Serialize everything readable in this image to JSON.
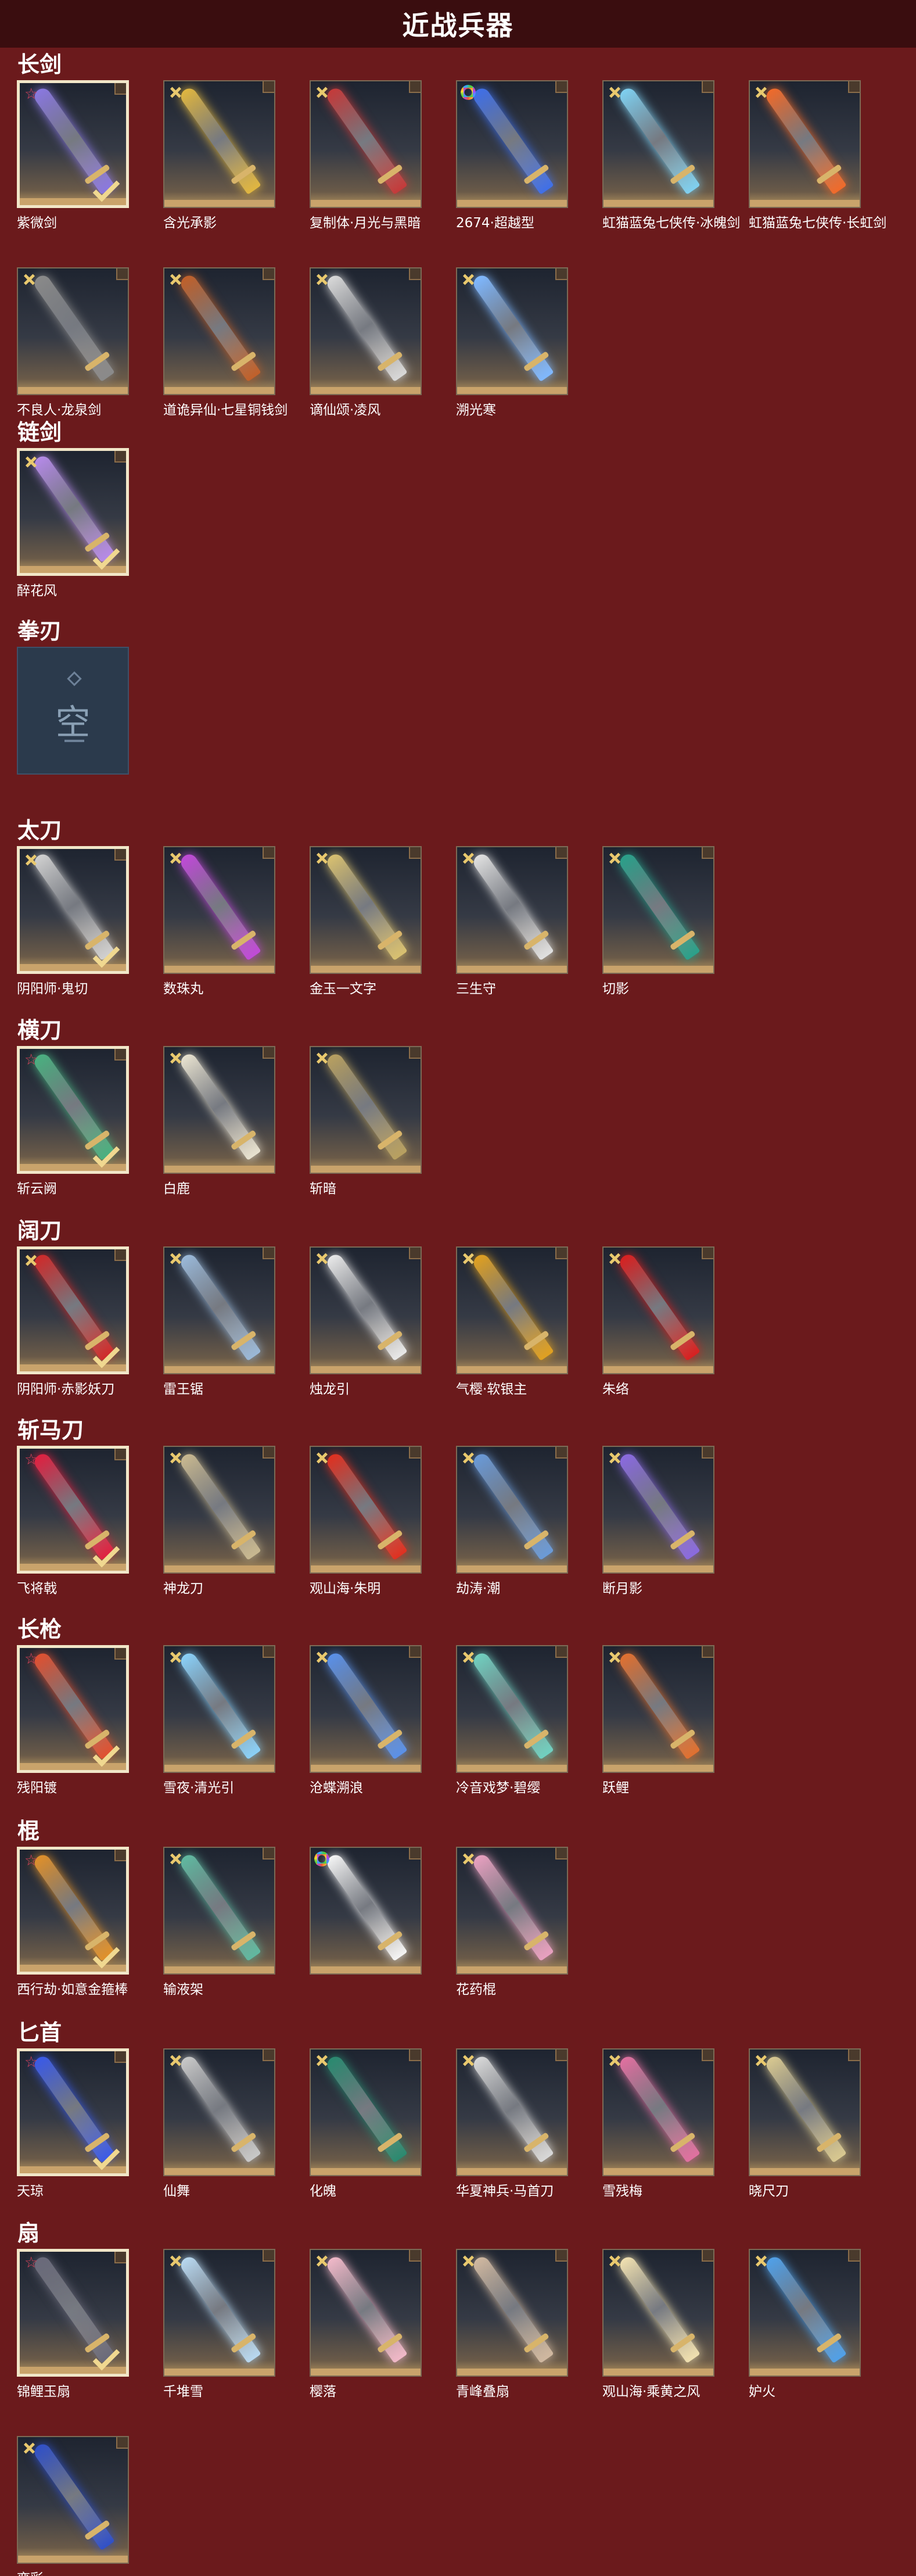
{
  "header": {
    "title": "近战兵器"
  },
  "sections": [
    {
      "name": "长剑",
      "items": [
        {
          "label": "紫微剑",
          "badge": "red",
          "selected": true,
          "color": "#8a78e0"
        },
        {
          "label": "含光承影",
          "badge": "gold",
          "selected": false,
          "color": "#e0b640"
        },
        {
          "label": "复制体·月光与黑暗",
          "badge": "gold",
          "selected": false,
          "color": "#c43a3a"
        },
        {
          "label": "2674·超越型",
          "badge": "rainbow",
          "selected": false,
          "color": "#3f6fe8"
        },
        {
          "label": "虹猫蓝兔七侠传·冰魄剑",
          "badge": "gold",
          "selected": false,
          "color": "#7fd0f0"
        },
        {
          "label": "虹猫蓝兔七侠传·长虹剑",
          "badge": "gold",
          "selected": false,
          "color": "#f06a2a"
        },
        {
          "label": "不良人·龙泉剑",
          "badge": "gold",
          "selected": false,
          "color": "#8a8a8a"
        },
        {
          "label": "道诡异仙·七星铜钱剑",
          "badge": "gold",
          "selected": false,
          "color": "#c0602a"
        },
        {
          "label": "谪仙颂·凌风",
          "badge": "gold",
          "selected": false,
          "color": "#d8d8d8"
        },
        {
          "label": "溯光寒",
          "badge": "gold",
          "selected": false,
          "color": "#7fb8ff"
        }
      ]
    },
    {
      "name": "链剑",
      "items": [
        {
          "label": "醉花风",
          "badge": "gold",
          "selected": true,
          "color": "#b58ae8"
        }
      ]
    },
    {
      "name": "拳刃",
      "items": [
        {
          "label": "",
          "badge": "none",
          "selected": false,
          "empty": true,
          "empty_glyph": "空",
          "color": "#2b3a4c"
        }
      ]
    },
    {
      "name": "太刀",
      "items": [
        {
          "label": "阴阳师·鬼切",
          "badge": "gold",
          "selected": true,
          "color": "#d0d0d0"
        },
        {
          "label": "数珠丸",
          "badge": "gold",
          "selected": false,
          "color": "#c04ad8"
        },
        {
          "label": "金玉一文字",
          "badge": "gold",
          "selected": false,
          "color": "#d8c070"
        },
        {
          "label": "三生守",
          "badge": "gold",
          "selected": false,
          "color": "#e0e0e0"
        },
        {
          "label": "切影",
          "badge": "gold",
          "selected": false,
          "color": "#2aa08a"
        }
      ]
    },
    {
      "name": "横刀",
      "items": [
        {
          "label": "斩云阙",
          "badge": "red",
          "selected": true,
          "color": "#4ab080"
        },
        {
          "label": "白鹿",
          "badge": "gold",
          "selected": false,
          "color": "#e8e2d0"
        },
        {
          "label": "斩暗",
          "badge": "gold",
          "selected": false,
          "color": "#b8a060"
        }
      ]
    },
    {
      "name": "阔刀",
      "items": [
        {
          "label": "阴阳师·赤影妖刀",
          "badge": "gold",
          "selected": true,
          "color": "#d02a2a"
        },
        {
          "label": "雷王锯",
          "badge": "gold",
          "selected": false,
          "color": "#9ab8d8"
        },
        {
          "label": "烛龙引",
          "badge": "gold",
          "selected": false,
          "color": "#e8e8e8"
        },
        {
          "label": "气樱·软银主",
          "badge": "gold",
          "selected": false,
          "color": "#e0a020"
        },
        {
          "label": "朱络",
          "badge": "gold",
          "selected": false,
          "color": "#d82020"
        }
      ]
    },
    {
      "name": "斩马刀",
      "items": [
        {
          "label": "飞将戟",
          "badge": "red",
          "selected": true,
          "color": "#e02040"
        },
        {
          "label": "神龙刀",
          "badge": "gold",
          "selected": false,
          "color": "#c8b890"
        },
        {
          "label": "观山海·朱明",
          "badge": "gold",
          "selected": false,
          "color": "#e03020"
        },
        {
          "label": "劫涛·潮",
          "badge": "gold",
          "selected": false,
          "color": "#6a9ad8"
        },
        {
          "label": "断月影",
          "badge": "gold",
          "selected": false,
          "color": "#8a6ae0"
        }
      ]
    },
    {
      "name": "长枪",
      "items": [
        {
          "label": "残阳镀",
          "badge": "red",
          "selected": true,
          "color": "#e05030"
        },
        {
          "label": "雪夜·清光引",
          "badge": "gold",
          "selected": false,
          "color": "#8ad0f8"
        },
        {
          "label": "沧蝶溯浪",
          "badge": "gold",
          "selected": false,
          "color": "#5a90e8"
        },
        {
          "label": "冷音戏梦·碧缨",
          "badge": "gold",
          "selected": false,
          "color": "#70d0c0"
        },
        {
          "label": "跃鲤",
          "badge": "gold",
          "selected": false,
          "color": "#e07030"
        }
      ]
    },
    {
      "name": "棍",
      "items": [
        {
          "label": "西行劫·如意金箍棒",
          "badge": "red",
          "selected": true,
          "color": "#e0902a"
        },
        {
          "label": "输液架",
          "badge": "gold",
          "selected": false,
          "color": "#60b8a0"
        },
        {
          "label": "",
          "badge": "rainbow",
          "selected": false,
          "color": "#f4f4f4"
        },
        {
          "label": "花药棍",
          "badge": "gold",
          "selected": false,
          "color": "#e8a0c0"
        }
      ]
    },
    {
      "name": "匕首",
      "items": [
        {
          "label": "天琼",
          "badge": "red",
          "selected": true,
          "color": "#3a5ae8"
        },
        {
          "label": "仙舞",
          "badge": "gold",
          "selected": false,
          "color": "#c8c8c8"
        },
        {
          "label": "化魄",
          "badge": "gold",
          "selected": false,
          "color": "#2a8a70"
        },
        {
          "label": "华夏神兵·马首刀",
          "badge": "gold",
          "selected": false,
          "color": "#d8d8d8"
        },
        {
          "label": "雪残梅",
          "badge": "gold",
          "selected": false,
          "color": "#e070a0"
        },
        {
          "label": "晓尺刀",
          "badge": "gold",
          "selected": false,
          "color": "#d8c890"
        }
      ]
    },
    {
      "name": "扇",
      "items": [
        {
          "label": "锦鲤玉扇",
          "badge": "red",
          "selected": true,
          "color": "#6a6a7a"
        },
        {
          "label": "千堆雪",
          "badge": "gold",
          "selected": false,
          "color": "#b8d8f0"
        },
        {
          "label": "樱落",
          "badge": "gold",
          "selected": false,
          "color": "#f0b8c8"
        },
        {
          "label": "青峰叠扇",
          "badge": "gold",
          "selected": false,
          "color": "#d0b8a0"
        },
        {
          "label": "观山海·乘黄之风",
          "badge": "gold",
          "selected": false,
          "color": "#f0e0b0"
        },
        {
          "label": "妒火",
          "badge": "gold",
          "selected": false,
          "color": "#50a0e8"
        },
        {
          "label": "弈彩",
          "badge": "gold",
          "selected": false,
          "color": "#3050c8"
        }
      ]
    }
  ]
}
